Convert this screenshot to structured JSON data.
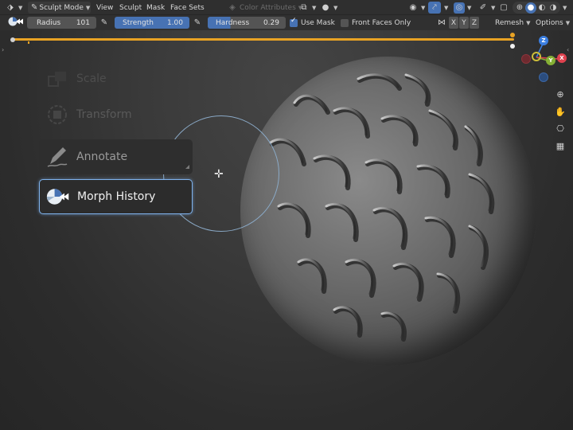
{
  "header": {
    "mode": "Sculpt Mode",
    "menu": [
      "View",
      "Sculpt",
      "Mask",
      "Face Sets"
    ],
    "color_attributes": "Color Attributes"
  },
  "tool_settings": {
    "radius_label": "Radius",
    "radius_value": "101",
    "strength_label": "Strength",
    "strength_value": "1.00",
    "hardness_label": "Hardness",
    "hardness_value": "0.29",
    "use_mask_label": "Use Mask",
    "use_mask_checked": true,
    "front_faces_label": "Front Faces Only",
    "front_faces_checked": false,
    "axes": [
      "X",
      "Y",
      "Z"
    ],
    "remesh_label": "Remesh",
    "options_label": "Options"
  },
  "menu": {
    "items": [
      {
        "label": "Scale",
        "icon": "scale-icon"
      },
      {
        "label": "Transform",
        "icon": "transform-icon"
      },
      {
        "label": "Annotate",
        "icon": "annotate-pen-icon"
      },
      {
        "label": "Morph History",
        "icon": "morph-history-icon",
        "selected": true
      }
    ]
  },
  "gizmo": {
    "z": "Z",
    "y": "Y",
    "x": "X"
  },
  "colors": {
    "accent": "#4772b3",
    "selection_glow": "#7fb2ec",
    "timeline": "#e9a324",
    "gizmo_x": "#e0424f",
    "gizmo_y": "#85b035",
    "gizmo_z": "#3b7ee0"
  }
}
